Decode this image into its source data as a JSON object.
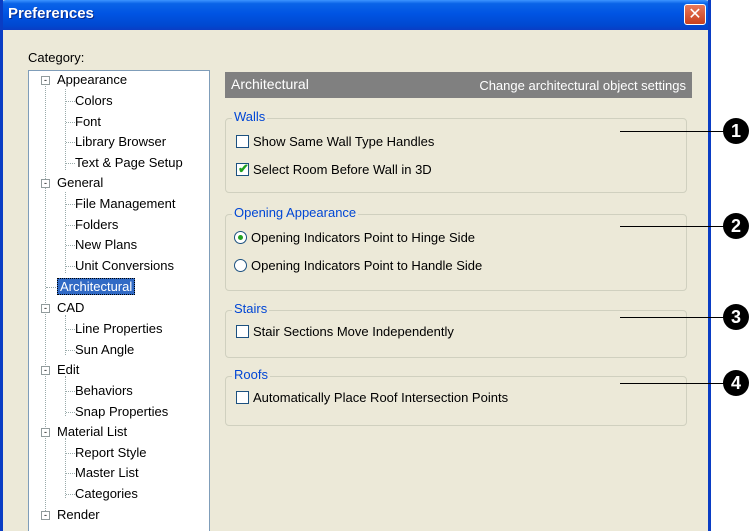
{
  "window": {
    "title": "Preferences"
  },
  "category_label": "Category:",
  "tree": [
    {
      "label": "Appearance",
      "expander": "-"
    },
    {
      "label": "Colors"
    },
    {
      "label": "Font"
    },
    {
      "label": "Library Browser"
    },
    {
      "label": "Text & Page Setup"
    },
    {
      "label": "General",
      "expander": "-"
    },
    {
      "label": "File Management"
    },
    {
      "label": "Folders"
    },
    {
      "label": "New Plans"
    },
    {
      "label": "Unit Conversions"
    },
    {
      "label": "Architectural",
      "selected": true
    },
    {
      "label": "CAD",
      "expander": "-"
    },
    {
      "label": "Line Properties"
    },
    {
      "label": "Sun Angle"
    },
    {
      "label": "Edit",
      "expander": "-"
    },
    {
      "label": "Behaviors"
    },
    {
      "label": "Snap Properties"
    },
    {
      "label": "Material List",
      "expander": "-"
    },
    {
      "label": "Report Style"
    },
    {
      "label": "Master List"
    },
    {
      "label": "Categories"
    },
    {
      "label": "Render",
      "expander": "-"
    }
  ],
  "panel": {
    "title": "Architectural",
    "description": "Change architectural object settings"
  },
  "groups": {
    "walls": {
      "title": "Walls",
      "show_same_wall_handles": "Show Same Wall Type Handles",
      "select_room_before_wall": "Select Room Before Wall in 3D"
    },
    "opening": {
      "title": "Opening Appearance",
      "hinge": "Opening Indicators Point to Hinge Side",
      "handle": "Opening Indicators Point to Handle Side"
    },
    "stairs": {
      "title": "Stairs",
      "sections_move": "Stair Sections Move Independently"
    },
    "roofs": {
      "title": "Roofs",
      "auto_place": "Automatically Place Roof Intersection Points"
    }
  },
  "callouts": [
    "1",
    "2",
    "3",
    "4"
  ],
  "colors": {
    "titlebar": "#0054e3",
    "group_title": "#0046d5",
    "selected": "#316ac5",
    "check": "#21a121",
    "panel_header": "#808080"
  }
}
